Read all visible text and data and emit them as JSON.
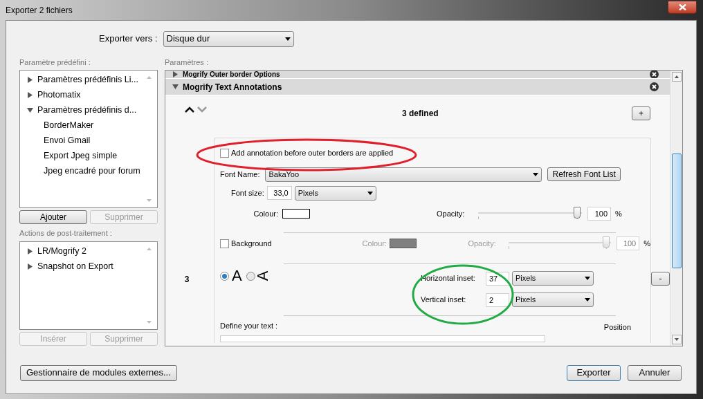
{
  "window": {
    "title": "Exporter 2 fichiers"
  },
  "export_to": {
    "label": "Exporter vers :",
    "value": "Disque dur"
  },
  "presets": {
    "label": "Paramètre prédéfini :",
    "items": [
      {
        "label": "Paramètres prédéfinis Li...",
        "expanded": false
      },
      {
        "label": "Photomatix",
        "expanded": false
      },
      {
        "label": "Paramètres prédéfinis d...",
        "expanded": true,
        "children": [
          {
            "label": "BorderMaker"
          },
          {
            "label": "Envoi Gmail"
          },
          {
            "label": "Export Jpeg simple"
          },
          {
            "label": "Jpeg encadré pour forum"
          }
        ]
      }
    ],
    "buttons": [
      {
        "label": "Ajouter",
        "disabled": false
      },
      {
        "label": "Supprimer",
        "disabled": true
      }
    ]
  },
  "post_actions": {
    "label": "Actions de post-traitement :",
    "items": [
      {
        "label": "LR/Mogrify 2",
        "expanded": false
      },
      {
        "label": "Snapshot on Export",
        "expanded": false
      }
    ],
    "buttons": [
      {
        "label": "Insérer",
        "disabled": true
      },
      {
        "label": "Supprimer",
        "disabled": true
      }
    ]
  },
  "params": {
    "label": "Paramètres :",
    "sections": [
      {
        "title": "Mogrify Outer border Options",
        "expanded": false
      },
      {
        "title": "Mogrify Text Annotations",
        "expanded": true
      }
    ],
    "count": "3 defined",
    "add": "+",
    "remove": "-",
    "index": "3",
    "before_borders": {
      "label": "Add annotation before outer borders are applied",
      "checked": false
    },
    "font_name": {
      "label": "Font Name:",
      "value": "BakaYoo"
    },
    "refresh": "Refresh Font List",
    "font_size": {
      "label": "Font size:",
      "value": "33,0",
      "unit": "Pixels"
    },
    "text_colour": {
      "label": "Colour:",
      "color": "#ffffff"
    },
    "text_opacity": {
      "label": "Opacity:",
      "level": 1,
      "value": "100",
      "unit": "%"
    },
    "background": {
      "label": "Background",
      "checked": false
    },
    "bg_colour": {
      "label": "Colour:",
      "color": "#808080"
    },
    "bg_opacity": {
      "label": "Opacity:",
      "level": 1,
      "value": "100",
      "unit": "%"
    },
    "orientation": [
      {
        "label": "A",
        "kind": "upright",
        "selected": true
      },
      {
        "label": "A",
        "kind": "rotated",
        "selected": false
      }
    ],
    "h_inset": {
      "label": "Horizontal inset:",
      "value": "37",
      "unit": "Pixels"
    },
    "v_inset": {
      "label": "Vertical inset:",
      "value": "2",
      "unit": "Pixels"
    },
    "define_text": "Define your text :",
    "position": "Position"
  },
  "footer": {
    "plugins": "Gestionnaire de modules externes...",
    "export": "Exporter",
    "cancel": "Annuler"
  }
}
